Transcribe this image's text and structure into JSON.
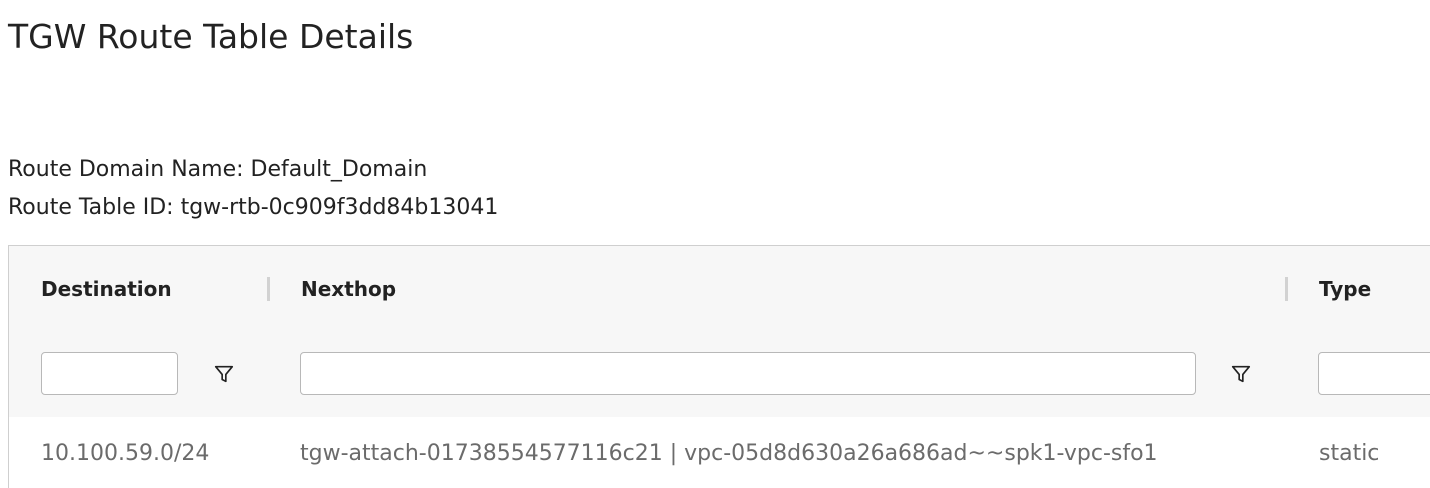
{
  "page": {
    "title": "TGW Route Table Details"
  },
  "meta": {
    "route_domain_name": "Route Domain Name: Default_Domain",
    "route_table_id": "Route Table ID: tgw-rtb-0c909f3dd84b13041"
  },
  "table": {
    "columns": [
      "Destination",
      "Nexthop",
      "Type"
    ],
    "filters": {
      "destination": "",
      "nexthop": "",
      "type": ""
    },
    "rows": [
      {
        "destination": "10.100.59.0/24",
        "nexthop": "tgw-attach-01738554577116c21 | vpc-05d8d630a26a686ad~~spk1-vpc-sfo1",
        "type": "static"
      }
    ]
  },
  "icons": {
    "filter": "filter-icon"
  }
}
